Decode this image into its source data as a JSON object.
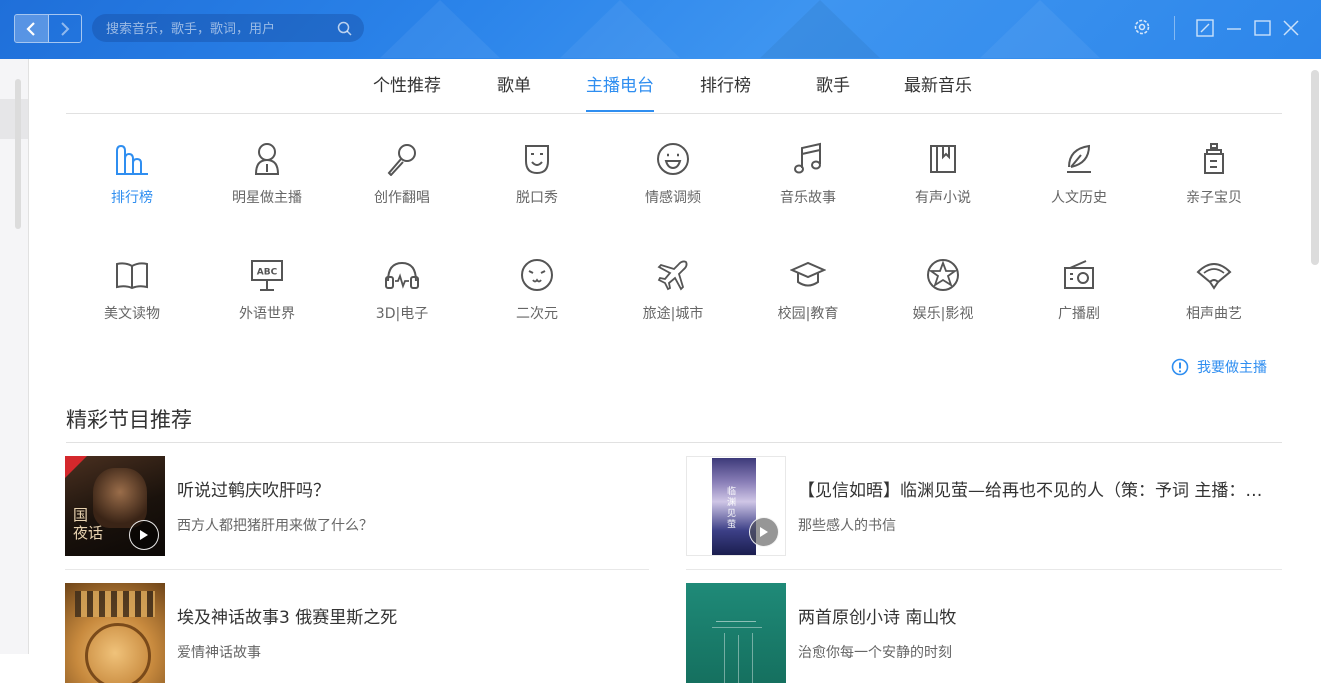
{
  "search": {
    "placeholder": "搜索音乐，歌手，歌词，用户"
  },
  "tabs": [
    {
      "label": "个性推荐"
    },
    {
      "label": "歌单"
    },
    {
      "label": "主播电台"
    },
    {
      "label": "排行榜"
    },
    {
      "label": "歌手"
    },
    {
      "label": "最新音乐"
    }
  ],
  "active_tab": "主播电台",
  "categories": [
    {
      "label": "排行榜",
      "icon": "ranking-icon"
    },
    {
      "label": "明星做主播",
      "icon": "star-host-icon"
    },
    {
      "label": "创作翻唱",
      "icon": "microphone-icon"
    },
    {
      "label": "脱口秀",
      "icon": "mask-icon"
    },
    {
      "label": "情感调频",
      "icon": "smile-icon"
    },
    {
      "label": "音乐故事",
      "icon": "music-note-icon"
    },
    {
      "label": "有声小说",
      "icon": "book-icon"
    },
    {
      "label": "人文历史",
      "icon": "quill-icon"
    },
    {
      "label": "亲子宝贝",
      "icon": "baby-bottle-icon"
    },
    {
      "label": "美文读物",
      "icon": "open-book-icon"
    },
    {
      "label": "外语世界",
      "icon": "abc-board-icon"
    },
    {
      "label": "3D|电子",
      "icon": "headphones-icon"
    },
    {
      "label": "二次元",
      "icon": "cute-face-icon"
    },
    {
      "label": "旅途|城市",
      "icon": "airplane-icon"
    },
    {
      "label": "校园|教育",
      "icon": "graduation-cap-icon"
    },
    {
      "label": "娱乐|影视",
      "icon": "film-reel-icon"
    },
    {
      "label": "广播剧",
      "icon": "radio-icon"
    },
    {
      "label": "相声曲艺",
      "icon": "fan-icon"
    }
  ],
  "apply_host": "我要做主播",
  "section_title": "精彩节目推荐",
  "programs": [
    {
      "title": "听说过鹌庆吹肝吗？",
      "desc": "西方人都把猪肝用来做了什么？"
    },
    {
      "title": "【见信如晤】临渊见萤—给再也不见的人（策：予词 主播：…",
      "desc": "那些感人的书信"
    },
    {
      "title": "埃及神话故事3 俄赛里斯之死",
      "desc": "爱情神话故事"
    },
    {
      "title": "两首原创小诗 南山牧",
      "desc": "治愈你每一个安静的时刻"
    }
  ],
  "colors": {
    "accent": "#2f8ef0",
    "topbar": "#2b84ea"
  }
}
